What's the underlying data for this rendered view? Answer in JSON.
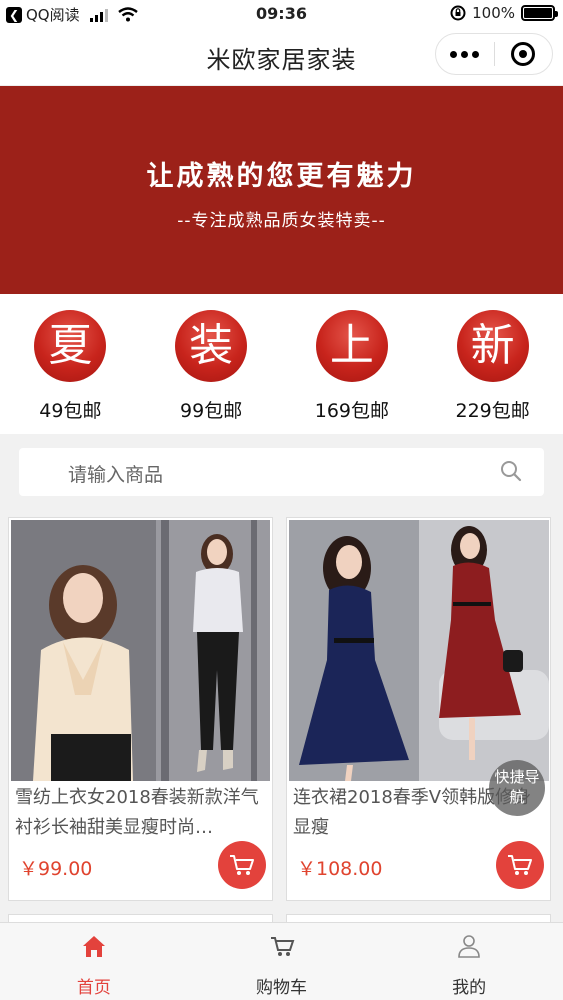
{
  "status_bar": {
    "carrier": "QQ阅读",
    "time": "09:36",
    "battery": "100%"
  },
  "navbar": {
    "title": "米欧家居家装"
  },
  "banner": {
    "headline": "让成熟的您更有魅力",
    "subline": "--专注成熟品质女装特卖--",
    "color": "#9c2119"
  },
  "promos": [
    {
      "char": "夏",
      "label": "49包邮"
    },
    {
      "char": "装",
      "label": "99包邮"
    },
    {
      "char": "上",
      "label": "169包邮"
    },
    {
      "char": "新",
      "label": "229包邮"
    }
  ],
  "search": {
    "placeholder": "请输入商品"
  },
  "products": [
    {
      "name": "雪纺上衣女2018春装新款洋气衬衫长袖甜美显瘦时尚…",
      "price": "￥99.00"
    },
    {
      "name": "连衣裙2018春季V领韩版修身显瘦",
      "price": "￥108.00"
    }
  ],
  "quick_nav": {
    "label": "快捷导航"
  },
  "tabbar": [
    {
      "label": "首页",
      "icon": "home-icon",
      "active": true
    },
    {
      "label": "购物车",
      "icon": "cart-icon",
      "active": false
    },
    {
      "label": "我的",
      "icon": "user-icon",
      "active": false
    }
  ],
  "colors": {
    "accent": "#e3423c",
    "price": "#e0442f"
  }
}
